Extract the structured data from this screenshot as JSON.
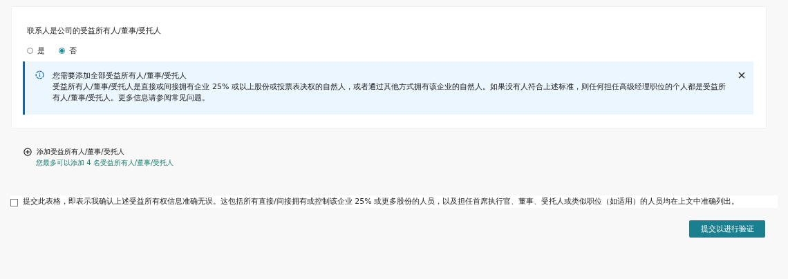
{
  "question": {
    "label": "联系人是公司的受益所有人/董事/受托人",
    "options": [
      {
        "label": "是",
        "selected": false
      },
      {
        "label": "否",
        "selected": true
      }
    ]
  },
  "alert": {
    "title": "您需要添加全部受益所有人/董事/受托人",
    "body": "受益所有人/董事/受托人是直接或间接拥有企业 25% 或以上股份或投票表决权的自然人，或者通过其他方式拥有该企业的自然人。如果没有人符合上述标准，则任何担任高级经理职位的个人都是受益所有人/董事/受托人。更多信息请参阅常见问题。"
  },
  "add_link": {
    "label": "添加受益所有人/董事/受托人",
    "note": "您最多可以添加 4 名受益所有人/董事/受托人"
  },
  "confirm": {
    "checked": false,
    "label": "提交此表格，即表示我确认上述受益所有权信息准确无误。这包括所有直接/间接拥有或控制该企业 25% 或更多股份的人员，以及担任首席执行官、董事、受托人或类似职位（如适用）的人员均在上文中准确列出。"
  },
  "submit_button": "提交以进行验证"
}
